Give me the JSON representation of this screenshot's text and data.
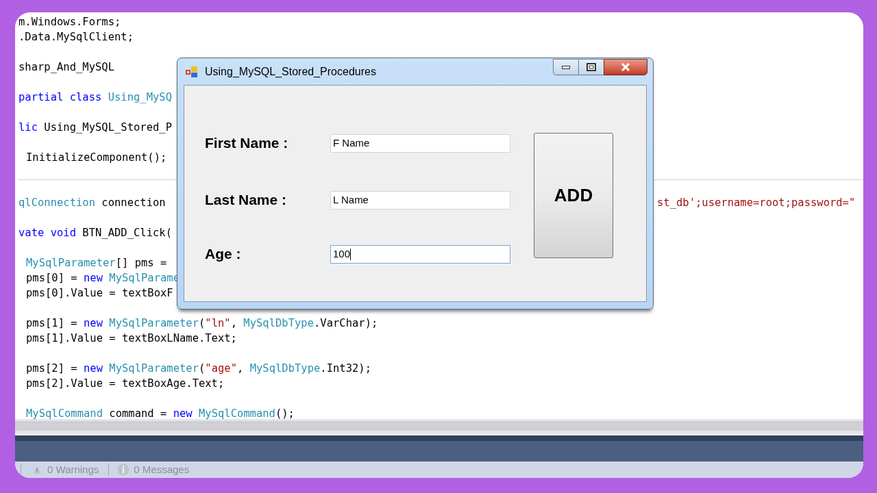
{
  "code_sections": [
    {
      "blocks": [
        {
          "indented": false,
          "lines": [
            [
              {
                "kind": "plain",
                "text": "m.Windows.Forms;"
              }
            ],
            [
              {
                "kind": "plain",
                "text": ".Data.MySqlClient;"
              }
            ]
          ]
        },
        {
          "indented": false,
          "lines": [
            [
              {
                "kind": "plain",
                "text": "sharp_And_MySQL"
              }
            ]
          ]
        },
        {
          "indented": false,
          "lines": [
            [
              {
                "kind": "keyword",
                "text": "partial class "
              },
              {
                "kind": "type",
                "text": "Using_MySQ"
              }
            ]
          ]
        },
        {
          "indented": false,
          "lines": [
            [
              {
                "kind": "keyword",
                "text": "lic "
              },
              {
                "kind": "plain",
                "text": "Using_MySQL_Stored_P"
              }
            ]
          ]
        },
        {
          "indented": true,
          "lines": [
            [
              {
                "kind": "plain",
                "text": "InitializeComponent();"
              }
            ]
          ]
        }
      ]
    },
    {
      "blocks": [
        {
          "indented": false,
          "lines": [
            [
              {
                "kind": "type",
                "text": "qlConnection"
              },
              {
                "kind": "plain",
                "text": " connection"
              }
            ]
          ],
          "right_text": "st_db';username=root;password=\""
        },
        {
          "indented": false,
          "lines": [
            [
              {
                "kind": "keyword",
                "text": "vate void "
              },
              {
                "kind": "plain",
                "text": "BTN_ADD_Click("
              }
            ]
          ]
        },
        {
          "indented": true,
          "lines": [
            [
              {
                "kind": "type",
                "text": "MySqlParameter"
              },
              {
                "kind": "plain",
                "text": "[] pms ="
              }
            ],
            [
              {
                "kind": "plain",
                "text": "pms[0] = "
              },
              {
                "kind": "keyword",
                "text": "new "
              },
              {
                "kind": "type",
                "text": "MySqlParame"
              }
            ],
            [
              {
                "kind": "plain",
                "text": "pms[0].Value = textBoxF"
              }
            ]
          ]
        },
        {
          "indented": true,
          "lines": [
            [
              {
                "kind": "plain",
                "text": "pms[1] = "
              },
              {
                "kind": "keyword",
                "text": "new "
              },
              {
                "kind": "type",
                "text": "MySqlParameter"
              },
              {
                "kind": "plain",
                "text": "("
              },
              {
                "kind": "string",
                "text": "\"ln\""
              },
              {
                "kind": "plain",
                "text": ", "
              },
              {
                "kind": "type",
                "text": "MySqlDbType"
              },
              {
                "kind": "plain",
                "text": ".VarChar);"
              }
            ],
            [
              {
                "kind": "plain",
                "text": "pms[1].Value = textBoxLName.Text;"
              }
            ]
          ]
        },
        {
          "indented": true,
          "lines": [
            [
              {
                "kind": "plain",
                "text": "pms[2] = "
              },
              {
                "kind": "keyword",
                "text": "new "
              },
              {
                "kind": "type",
                "text": "MySqlParameter"
              },
              {
                "kind": "plain",
                "text": "("
              },
              {
                "kind": "string",
                "text": "\"age\""
              },
              {
                "kind": "plain",
                "text": ", "
              },
              {
                "kind": "type",
                "text": "MySqlDbType"
              },
              {
                "kind": "plain",
                "text": ".Int32);"
              }
            ],
            [
              {
                "kind": "plain",
                "text": "pms[2].Value = textBoxAge.Text;"
              }
            ]
          ]
        },
        {
          "indented": true,
          "lines": [
            [
              {
                "kind": "type",
                "text": "MySqlCommand"
              },
              {
                "kind": "plain",
                "text": " command = "
              },
              {
                "kind": "keyword",
                "text": "new "
              },
              {
                "kind": "type",
                "text": "MySqlCommand"
              },
              {
                "kind": "plain",
                "text": "();"
              }
            ]
          ]
        }
      ]
    }
  ],
  "status_bar": {
    "warnings": "0 Warnings",
    "messages": "0 Messages"
  },
  "dialog": {
    "title": "Using_MySQL_Stored_Procedures",
    "fields": [
      {
        "label": "First Name :",
        "value": "F Name",
        "focused": false
      },
      {
        "label": "Last Name :",
        "value": "L Name",
        "focused": false
      },
      {
        "label": "Age :",
        "value": "100",
        "focused": true
      }
    ],
    "button": "ADD"
  }
}
